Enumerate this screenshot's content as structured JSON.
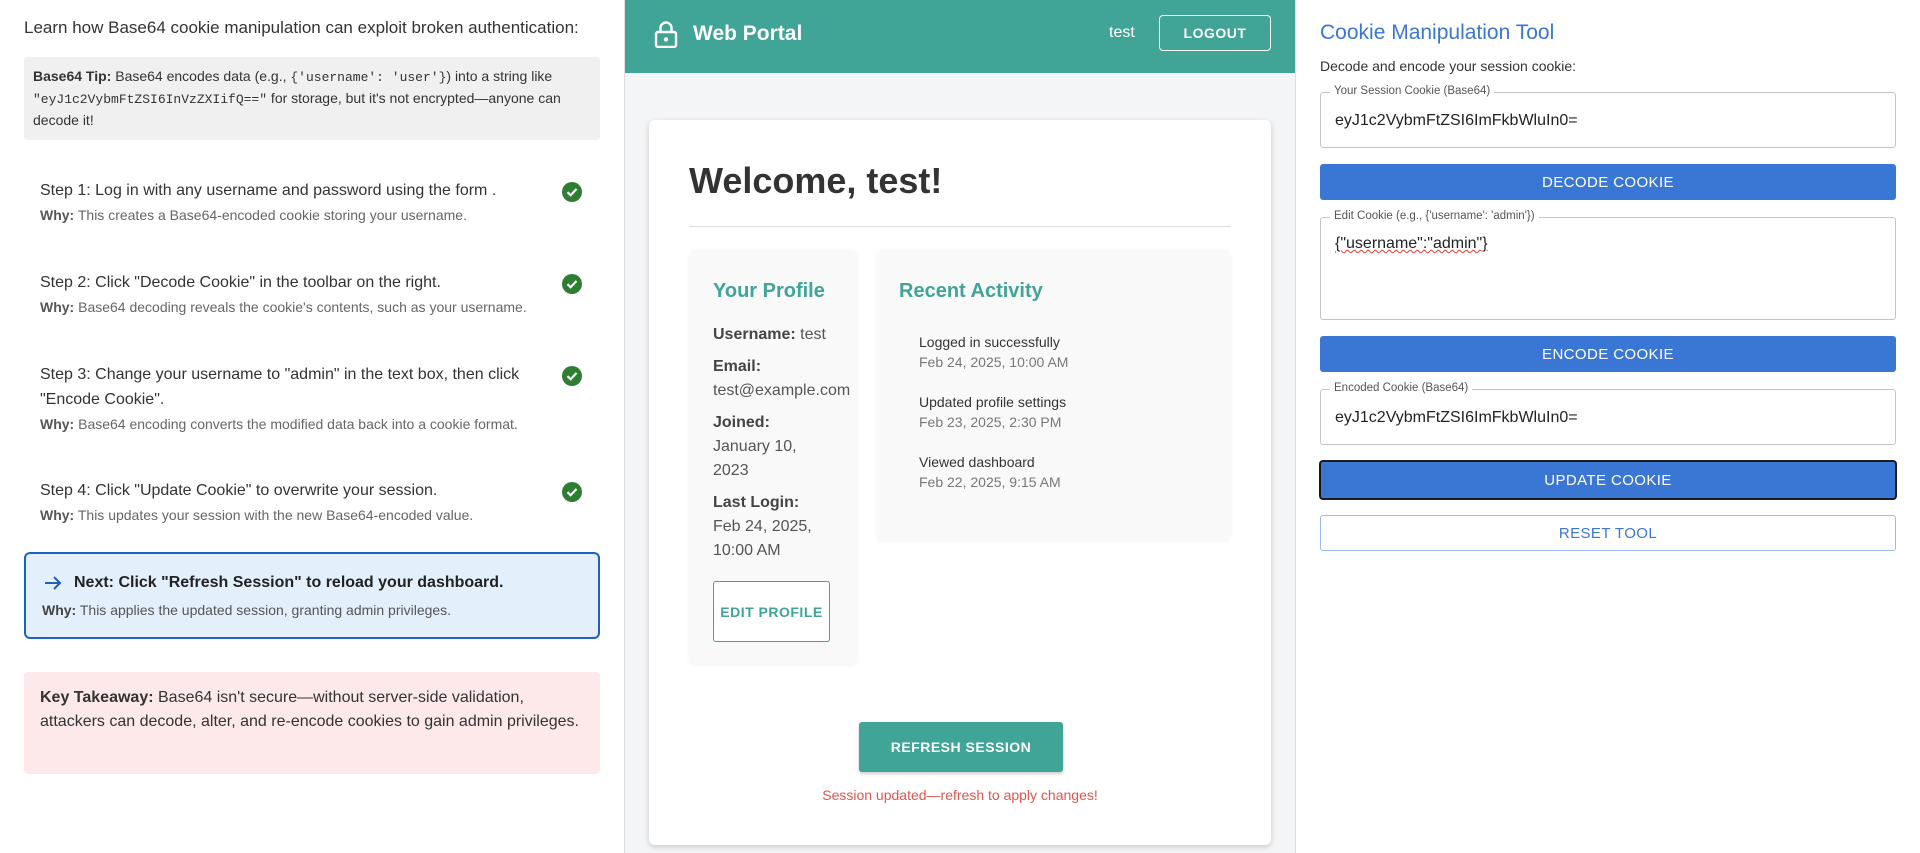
{
  "tutorial": {
    "intro": "Learn how Base64 cookie manipulation can exploit broken authentication:",
    "tip": {
      "label": "Base64 Tip:",
      "text_1": " Base64 encodes data (e.g., ",
      "code_1": "{'username': 'user'}",
      "text_2": ") into a string like ",
      "code_2": "\"eyJ1c2VybmFtZSI6InVzZXIifQ==\"",
      "text_3": " for storage, but it's not encrypted—anyone can decode it!"
    },
    "steps": [
      {
        "title": "Step 1: Log in with any username and password using the form .",
        "why_label": "Why:",
        "why": " This creates a Base64-encoded cookie storing your username.",
        "done": true
      },
      {
        "title": "Step 2: Click \"Decode Cookie\" in the toolbar on the right.",
        "why_label": "Why:",
        "why": " Base64 decoding reveals the cookie's contents, such as your username.",
        "done": true
      },
      {
        "title": "Step 3: Change your username to \"admin\" in the text box, then click \"Encode Cookie\".",
        "why_label": "Why:",
        "why": " Base64 encoding converts the modified data back into a cookie format.",
        "done": true
      },
      {
        "title": "Step 4: Click \"Update Cookie\" to overwrite your session.",
        "why_label": "Why:",
        "why": " This updates your session with the new Base64-encoded value.",
        "done": true
      }
    ],
    "next": {
      "title": "Next: Click \"Refresh Session\" to reload your dashboard.",
      "why_label": "Why:",
      "why": " This applies the updated session, granting admin privileges."
    },
    "takeaway": {
      "label": "Key Takeaway:",
      "text": " Base64 isn't secure—without server-side validation, attackers can decode, alter, and re-encode cookies to gain admin privileges."
    }
  },
  "portal": {
    "brand": "Web Portal",
    "username": "test",
    "logout_label": "LOGOUT",
    "welcome": "Welcome, test!",
    "profile": {
      "title": "Your Profile",
      "username_label": "Username:",
      "username": " test",
      "email_label": "Email:",
      "email": "test@example.com",
      "joined_label": "Joined:",
      "joined": "January 10, 2023",
      "last_login_label": "Last Login:",
      "last_login": "Feb 24, 2025, 10:00 AM",
      "edit_label": "EDIT PROFILE"
    },
    "activity": {
      "title": "Recent Activity",
      "items": [
        {
          "text": "Logged in successfully",
          "date": "Feb 24, 2025, 10:00 AM"
        },
        {
          "text": "Updated profile settings",
          "date": "Feb 23, 2025, 2:30 PM"
        },
        {
          "text": "Viewed dashboard",
          "date": "Feb 22, 2025, 9:15 AM"
        }
      ]
    },
    "refresh_label": "REFRESH SESSION",
    "session_message": "Session updated—refresh to apply changes!"
  },
  "tool": {
    "title": "Cookie Manipulation Tool",
    "subtitle": "Decode and encode your session cookie:",
    "session_cookie": {
      "label": "Your Session Cookie (Base64)",
      "value": "eyJ1c2VybmFtZSI6ImFkbWluIn0="
    },
    "decode_label": "DECODE COOKIE",
    "edit_cookie": {
      "label": "Edit Cookie (e.g., {'username': 'admin'})",
      "value": "{\"username\":\"admin\"}"
    },
    "encode_label": "ENCODE COOKIE",
    "encoded_cookie": {
      "label": "Encoded Cookie (Base64)",
      "value": "eyJ1c2VybmFtZSI6ImFkbWluIn0="
    },
    "update_label": "UPDATE COOKIE",
    "reset_label": "RESET TOOL"
  },
  "colors": {
    "teal": "#40a497",
    "blue": "#3a76d4",
    "success_green": "#2e7d32",
    "error_red": "#e0564f",
    "next_bg": "#e3f0fc",
    "takeaway_bg": "#fde8ea"
  },
  "icons": {
    "lock": "lock-icon",
    "check": "check-circle-icon",
    "arrow": "arrow-right-icon"
  }
}
